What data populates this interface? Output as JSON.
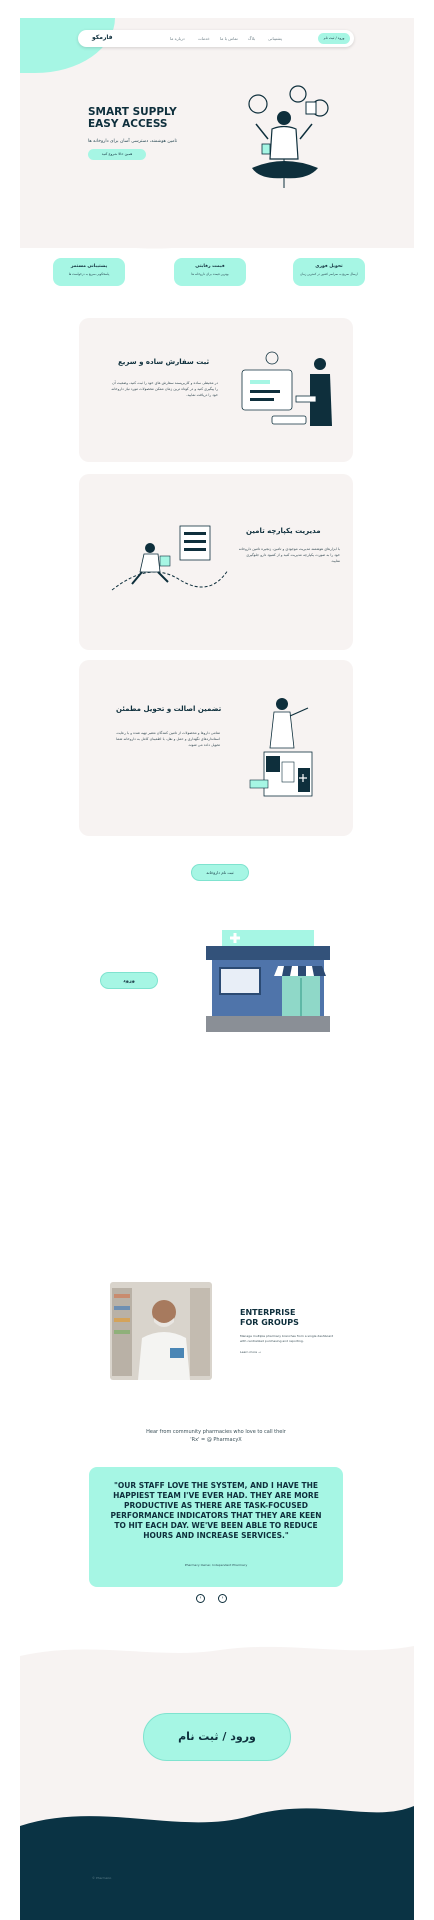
{
  "nav": {
    "logo": "فارمکو",
    "links": [
      "درباره ما",
      "خدمات",
      "تماس با ما",
      "بلاگ",
      "پشتیبانی"
    ],
    "cta": "ورود / ثبت نام"
  },
  "hero": {
    "title_line1": "SMART SUPPLY",
    "title_line2": "EASY ACCESS",
    "subtitle": "تامین هوشمند، دسترسی آسان برای داروخانه ها",
    "cta": "همین حالا شروع کنید"
  },
  "features": [
    {
      "title": "پشتیبانی مستمر",
      "subtitle": "پاسخگویی سریع به درخواست ها"
    },
    {
      "title": "قیمت رقابتی",
      "subtitle": "بهترین قیمت برای داروخانه ها"
    },
    {
      "title": "تحویل فوری",
      "subtitle": "ارسال سریع به سراسر کشور در کمترین زمان"
    }
  ],
  "blocks": [
    {
      "title": "ثبت سفارش ساده و سریع",
      "text": "در محیطی ساده و کاربرپسند سفارش های خود را ثبت کنید، وضعیت آن را پیگیری کنید و در کوتاه ترین زمان ممکن محصولات مورد نیاز داروخانه خود را دریافت نمایید."
    },
    {
      "title": "مدیریت یکپارچه تامین",
      "text": "با ابزارهای هوشمند مدیریت موجودی و تامین، زنجیره تامین داروخانه خود را به صورت یکپارچه مدیریت کنید و از کمبود دارو جلوگیری نمایید."
    },
    {
      "title": "تضمین اصالت و تحویل مطمئن",
      "text": "تمامی داروها و محصولات از تامین کنندگان معتبر تهیه شده و با رعایت استانداردهای نگهداری و حمل و نقل، با اطمینان کامل به داروخانه شما تحویل داده می شوند."
    }
  ],
  "register_pill": "ثبت نام داروخانه",
  "store_pill": "ورود",
  "enterprise": {
    "title_line1": "ENTERPRISE",
    "title_line2": "FOR GROUPS",
    "text": "Manage multiple pharmacy branches from a single dashboard with centralized purchasing and reporting.",
    "link": "Learn more →"
  },
  "testimonials": {
    "heading_line1": "Hear from community pharmacies who love to call their",
    "heading_line2": "'Rx' = @ PharmacyX",
    "quote": "\"OUR STAFF LOVE THE SYSTEM, AND I HAVE THE HAPPIEST TEAM I'VE EVER HAD. THEY ARE MORE PRODUCTIVE AS THERE ARE TASK-FOCUSED PERFORMANCE INDICATORS THAT THEY ARE KEEN TO HIT EACH DAY. WE'VE BEEN ABLE TO REDUCE HOURS AND INCREASE SERVICES.\"",
    "author": "Pharmacy Owner, Independent Pharmacy"
  },
  "footer": {
    "cta": "ورود / ثبت نام",
    "copyright": "© PharmaCo"
  },
  "colors": {
    "mint": "#a6f6e4",
    "navy": "#0e2f3c",
    "cream": "#f7f3f2",
    "footer_dark": "#0a3344"
  }
}
